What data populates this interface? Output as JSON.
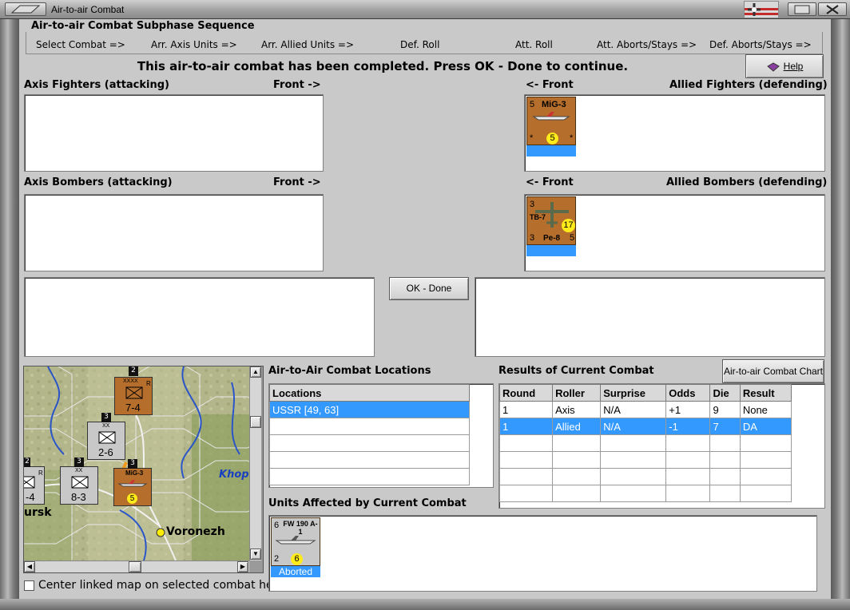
{
  "window": {
    "title": "Air-to-air Combat"
  },
  "sequence": {
    "legend": "Air-to-air Combat Subphase Sequence",
    "steps": [
      "Select Combat =>",
      "Arr. Axis Units =>",
      "Arr. Allied Units =>",
      "Def. Roll",
      "Att. Roll",
      "Att. Aborts/Stays =>",
      "Def. Aborts/Stays =>"
    ]
  },
  "notice": "This air-to-air combat has been completed.  Press OK - Done to continue.",
  "help_button": {
    "label": "Help"
  },
  "axis_fighters": {
    "label": "Axis Fighters (attacking)",
    "front": "Front ->"
  },
  "allied_fighters": {
    "label": "Allied Fighters (defending)",
    "front": "<- Front",
    "units": [
      {
        "name": "MiG-3",
        "top_left": "5",
        "center": "5",
        "bottom_left": "*",
        "bottom_right": "*",
        "strip_color": "#3399ff"
      }
    ]
  },
  "axis_bombers": {
    "label": "Axis Bombers (attacking)",
    "front": "Front ->"
  },
  "allied_bombers": {
    "label": "Allied Bombers (defending)",
    "front": "<- Front",
    "units": [
      {
        "name": "Pe-8",
        "side_name": "TB-7",
        "top_left": "3",
        "center": "17",
        "bottom_left": "3",
        "bottom_right": "5",
        "strip_color": "#3399ff"
      }
    ]
  },
  "ok_button": {
    "label": "OK - Done"
  },
  "map": {
    "city": "Voronezh",
    "river": "Khope",
    "edge_city": "ursk",
    "checkbox_label": "Center linked map on selected combat hex",
    "checkbox_checked": false,
    "units": [
      {
        "corps": "XXXX",
        "type": "R",
        "strength": "7-4",
        "stack": "2",
        "side": "Axis",
        "id": "inf-7-4"
      },
      {
        "corps": "XX",
        "strength": "2-6",
        "stack": "3",
        "side": "Axis-grey",
        "id": "inf-2-6"
      },
      {
        "corps": "XX",
        "strength": "8-3",
        "stack": "3",
        "side": "Axis-grey",
        "id": "inf-8-3"
      },
      {
        "corps": "R",
        "strength": "-4",
        "stack": "2",
        "side": "Axis-grey",
        "id": "inf-edge"
      },
      {
        "name": "MiG-3",
        "center": "5",
        "stack": "3",
        "side": "Allied",
        "id": "mig"
      }
    ]
  },
  "locations": {
    "title": "Air-to-Air Combat Locations",
    "column": "Locations",
    "rows": [
      "USSR [49, 63]",
      "",
      "",
      "",
      "",
      ""
    ]
  },
  "results": {
    "title": "Results of Current Combat",
    "chart_button": "Air-to-air Combat Chart",
    "columns": [
      "Round",
      "Roller",
      "Surprise",
      "Odds",
      "Die",
      "Result"
    ],
    "rows": [
      [
        "1",
        "Axis",
        "N/A",
        "+1",
        "9",
        "None"
      ],
      [
        "1",
        "Allied",
        "N/A",
        "-1",
        "7",
        "DA"
      ],
      [
        "",
        "",
        "",
        "",
        "",
        ""
      ],
      [
        "",
        "",
        "",
        "",
        "",
        ""
      ],
      [
        "",
        "",
        "",
        "",
        "",
        ""
      ],
      [
        "",
        "",
        "",
        "",
        "",
        ""
      ]
    ],
    "selected_row": 1
  },
  "affected": {
    "title": "Units Affected by Current Combat",
    "units": [
      {
        "name": "FW 190 A-1",
        "top_left": "6",
        "center": "6",
        "bottom_left": "2",
        "status": "Aborted"
      }
    ]
  },
  "colors": {
    "selection": "#3399ff",
    "axis_counter": "#b56e2b",
    "counter_dot": "#ffeb1a"
  }
}
